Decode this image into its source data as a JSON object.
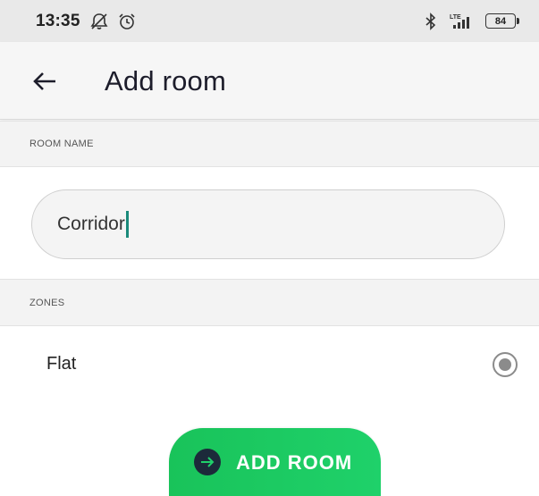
{
  "status_bar": {
    "time": "13:35",
    "network": "LTE",
    "battery": "84",
    "icons": [
      "notifications-off-icon",
      "alarm-icon",
      "bluetooth-icon",
      "signal-icon",
      "battery-icon"
    ]
  },
  "app_bar": {
    "title": "Add room",
    "back_icon": "arrow-left-icon"
  },
  "room_name_section": {
    "header": "ROOM NAME",
    "input_value": "Corridor"
  },
  "zones_section": {
    "header": "ZONES",
    "items": [
      {
        "label": "Flat",
        "selected": true
      }
    ]
  },
  "primary_button": {
    "label": "ADD ROOM",
    "icon": "arrow-right-circle-icon",
    "color": "#1fd16a"
  },
  "colors": {
    "accent": "#1fd16a",
    "caret": "#1a8a7a",
    "title_text": "#1d1d2b"
  }
}
